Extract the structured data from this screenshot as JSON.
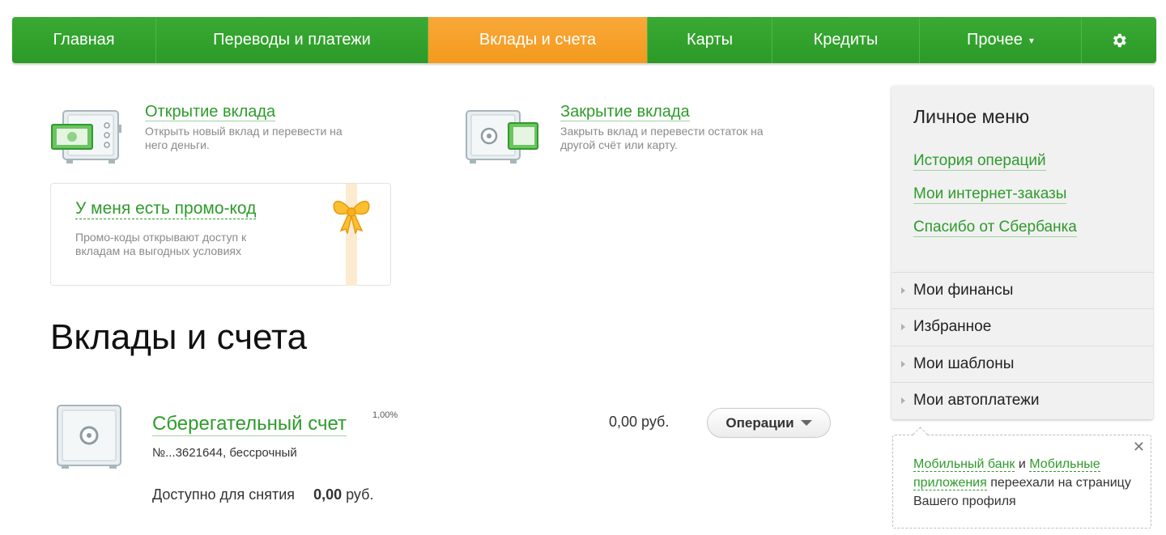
{
  "nav": {
    "items": [
      {
        "label": "Главная"
      },
      {
        "label": "Переводы и платежи"
      },
      {
        "label": "Вклады и счета"
      },
      {
        "label": "Карты"
      },
      {
        "label": "Кредиты"
      },
      {
        "label": "Прочее"
      }
    ],
    "active_index": 2,
    "more_caret": "▾",
    "settings_icon": "gear-icon"
  },
  "actions": {
    "open": {
      "title": "Открытие вклада",
      "description": "Открыть новый вклад и перевести на него деньги."
    },
    "close": {
      "title": "Закрытие вклада",
      "description": "Закрыть вклад и перевести остаток на другой счёт или карту."
    }
  },
  "promo": {
    "title": "У меня есть промо-код",
    "description": "Промо-коды открывают доступ к вкладам на выгодных условиях",
    "icon": "gift-bow-icon"
  },
  "page_title": "Вклады и счета",
  "account": {
    "name": "Сберегательный счет",
    "rate": "1,00%",
    "number": "№...3621644, бессрочный",
    "balance": "0,00 руб.",
    "available_label": "Доступно для снятия",
    "available_value": "0,00",
    "available_currency": "руб.",
    "operations_label": "Операции"
  },
  "personal_menu": {
    "title": "Личное меню",
    "links": [
      "История операций",
      "Мои интернет-заказы",
      "Спасибо от Сбербанка"
    ],
    "sections": [
      "Мои финансы",
      "Избранное",
      "Мои шаблоны",
      "Мои автоплатежи"
    ]
  },
  "notice": {
    "link1": "Мобильный банк",
    "and": "и",
    "link2": "Мобильные приложения",
    "rest": "переехали на страницу Вашего профиля",
    "close_icon": "close-icon"
  },
  "colors": {
    "brand_green": "#2b9a26",
    "accent_orange": "#f39a1d",
    "link_green": "#2e9b2b"
  }
}
